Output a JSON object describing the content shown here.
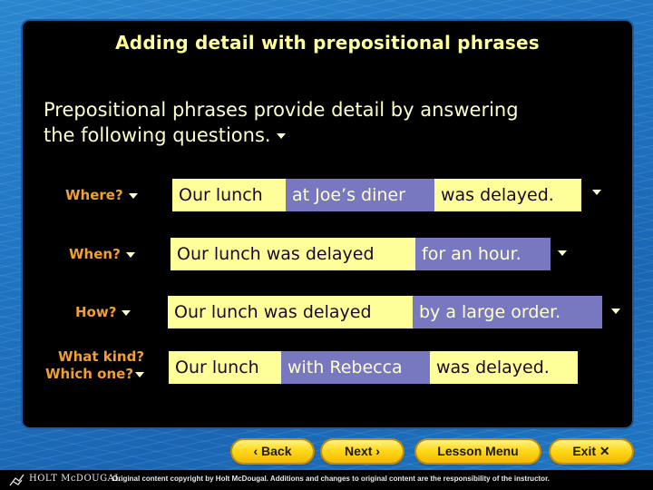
{
  "title": "Adding detail with prepositional phrases",
  "intro": {
    "line1": "Prepositional phrases provide detail by answering",
    "line2": "the following questions."
  },
  "rows": [
    {
      "question": "Where?",
      "segments": [
        {
          "text": "Our lunch",
          "type": "sentence"
        },
        {
          "text": "at Joe’s diner",
          "type": "phrase"
        },
        {
          "text": "was delayed.",
          "type": "sentence"
        }
      ]
    },
    {
      "question": "When?",
      "segments": [
        {
          "text": "Our lunch was delayed",
          "type": "sentence"
        },
        {
          "text": "for an hour.",
          "type": "phrase"
        }
      ]
    },
    {
      "question": "How?",
      "segments": [
        {
          "text": "Our lunch was delayed",
          "type": "sentence"
        },
        {
          "text": "by a large order.",
          "type": "phrase"
        }
      ]
    },
    {
      "question_line1": "What kind?",
      "question_line2": "Which one?",
      "segments": [
        {
          "text": "Our lunch",
          "type": "sentence"
        },
        {
          "text": "with Rebecca",
          "type": "phrase"
        },
        {
          "text": "was delayed.",
          "type": "sentence"
        }
      ]
    }
  ],
  "nav": {
    "back": "‹ Back",
    "next": "Next ›",
    "menu": "Lesson Menu",
    "exit": "Exit ✕"
  },
  "footer": {
    "brand": "HOLT McDOUGAL",
    "copyright": "Original content copyright by Holt McDougal. Additions and changes to original content are the responsibility of the instructor."
  },
  "colors": {
    "title": "#ffff99",
    "question": "#f0a030",
    "sentence_bg": "#ffff99",
    "phrase_bg": "#7878c0",
    "panel": "#000000",
    "button": "#ffd91a"
  }
}
